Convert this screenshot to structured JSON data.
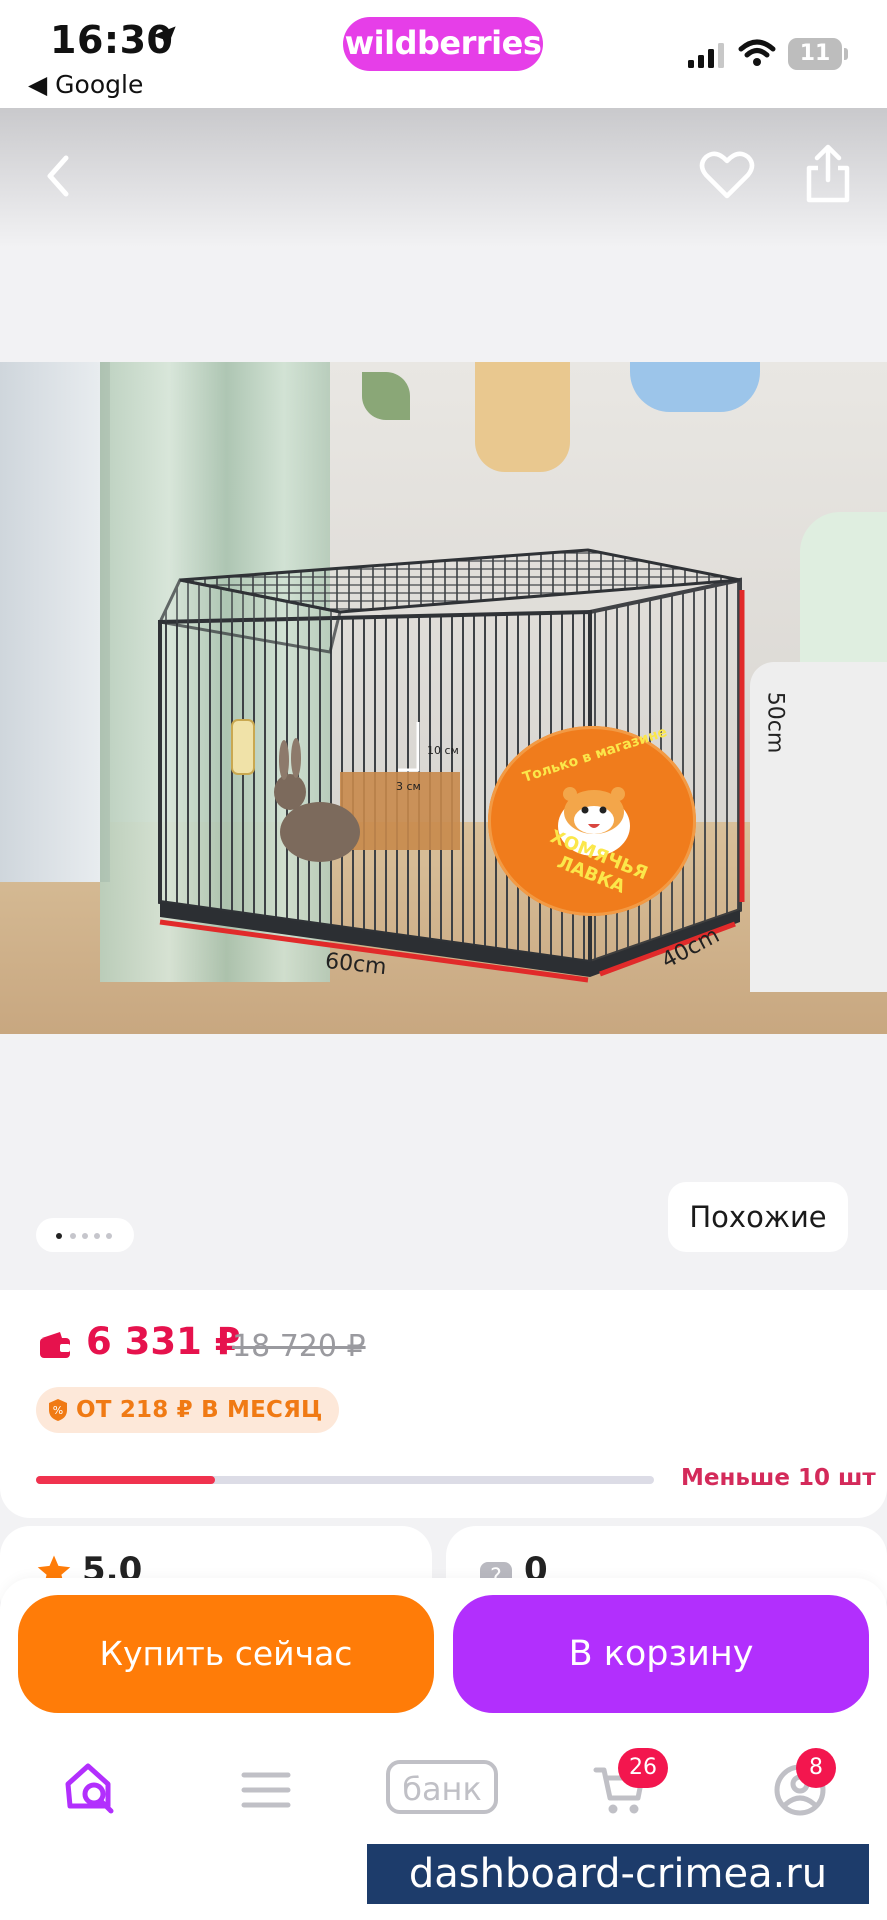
{
  "status_bar": {
    "time": "16:30",
    "back_app": "◀ Google",
    "battery": "11"
  },
  "app": {
    "logo": "wildberries",
    "brand_color": "#e63ee8"
  },
  "gallery": {
    "dimensions": {
      "length": "60cm",
      "width": "40cm",
      "height": "50cm",
      "door_height": "10 см",
      "door_width": "3 см"
    },
    "shop_badge": {
      "top_text": "Только в магазине",
      "bottom_text": "ХОМЯЧЬЯ ЛАВКА"
    },
    "similar_label": "Похожие",
    "page_count": 5,
    "active_page": 1
  },
  "price": {
    "current": "6 331 ₽",
    "old": "18 720 ₽",
    "installment": "ОТ 218 ₽ В МЕСЯЦ",
    "stock_text": "Меньше 10 шт",
    "stock_level_fraction": 0.29,
    "price_color": "#e6124d"
  },
  "stats": {
    "rating": "5.0",
    "questions": "0"
  },
  "actions": {
    "buy_now": "Купить сейчас",
    "add_to_cart": "В корзину",
    "buy_color": "#ff7c08",
    "cart_color": "#b22ffd"
  },
  "tab_bar": {
    "bank_label": "банк",
    "cart_badge": "26",
    "profile_badge": "8",
    "icons": [
      "home-search-icon",
      "menu-icon",
      "bank-icon",
      "cart-icon",
      "profile-icon"
    ]
  },
  "watermark": "dashboard-crimea.ru"
}
